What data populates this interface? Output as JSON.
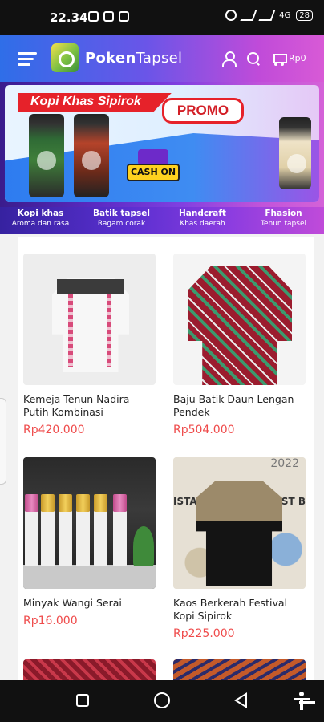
{
  "status_bar": {
    "time": "22.34",
    "network_badge": "4G",
    "battery": "28"
  },
  "header": {
    "brand_bold": "Poken",
    "brand_light": "Tapsel",
    "cart_total": "Rp0"
  },
  "banner": {
    "title": "Kopi Khas Sipirok",
    "promo_label": "PROMO",
    "cod_label": "CASH ON"
  },
  "categories": [
    {
      "title": "Kopi khas",
      "subtitle": "Aroma dan rasa"
    },
    {
      "title": "Batik tapsel",
      "subtitle": "Ragam corak"
    },
    {
      "title": "Handcraft",
      "subtitle": "Khas daerah"
    },
    {
      "title": "Fhasion",
      "subtitle": "Tenun tapsel"
    }
  ],
  "products": [
    {
      "name": "Kemeja Tenun Nadira Putih Kombinasi",
      "price": "Rp420.000"
    },
    {
      "name": "Baju Batik Daun Lengan Pendek",
      "price": "Rp504.000"
    },
    {
      "name": "Minyak Wangi Serai",
      "price": "Rp16.000"
    },
    {
      "name": "Kaos Berkerah Festival Kopi Sipirok",
      "price": "Rp225.000"
    }
  ],
  "kaos_print": {
    "year": "2022",
    "left_text": "ISTA",
    "right_text": "AST B"
  },
  "colors": {
    "accent_price": "#ef4b4b",
    "header_start": "#2f6ee8",
    "header_end": "#d85ad6"
  }
}
